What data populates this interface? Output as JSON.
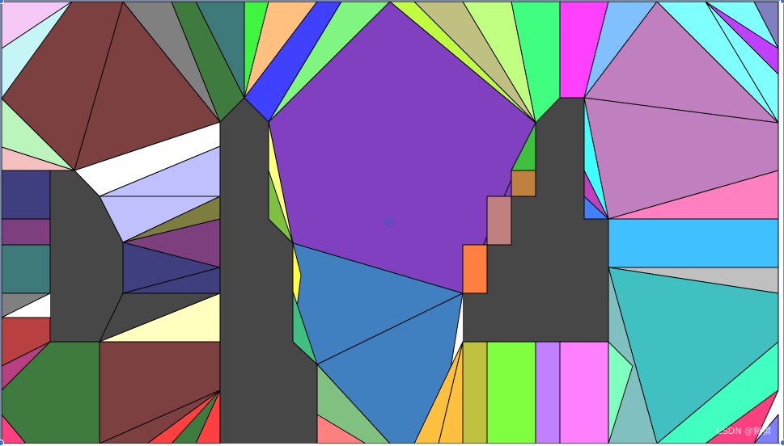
{
  "colors": {
    "obstacle": "#474747",
    "edge": "#000000",
    "frame": "#7a8aa6",
    "cursor": "#3b58c8"
  },
  "watermark": {
    "text": "CSDN @無惧"
  }
}
